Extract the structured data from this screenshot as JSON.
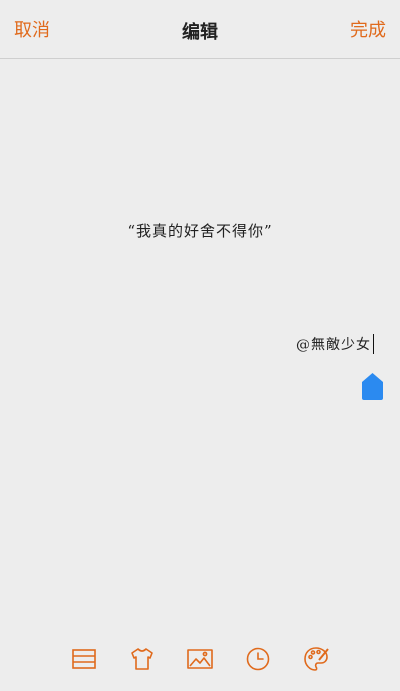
{
  "header": {
    "cancel_label": "取消",
    "title": "编辑",
    "done_label": "完成"
  },
  "content": {
    "quote": "“我真的好舍不得你”",
    "signature": "@無敵少女"
  },
  "toolbar": {
    "tools": [
      {
        "name": "layout-icon"
      },
      {
        "name": "shirt-icon"
      },
      {
        "name": "image-icon"
      },
      {
        "name": "clock-icon"
      },
      {
        "name": "palette-icon"
      }
    ]
  },
  "colors": {
    "accent": "#e06a1c",
    "handle": "#2b8af0",
    "background": "#ededed"
  }
}
